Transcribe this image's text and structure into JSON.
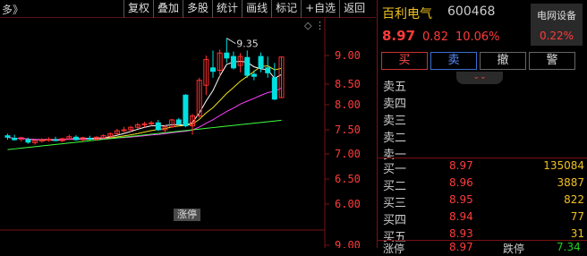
{
  "toolbar": {
    "left_text": "多》",
    "buttons": [
      "复权",
      "叠加",
      "多股",
      "统计",
      "画线",
      "标记",
      "+自选",
      "返回"
    ]
  },
  "chart": {
    "y_labels": [
      "9.00",
      "8.50",
      "8.00",
      "7.50",
      "7.00",
      "6.50",
      "6.00",
      "9.00"
    ],
    "high_marker": "9.35",
    "limit_badge": "涨停",
    "colors": {
      "up": "#ff3030",
      "down": "#00e0e0",
      "ma5": "#ffffff",
      "ma10": "#f0e020",
      "ma20": "#ff40ff",
      "ma60": "#40ff40"
    }
  },
  "stock": {
    "name": "百利电气",
    "code": "600468",
    "price": "8.97",
    "change": "0.82",
    "change_pct": "10.06%"
  },
  "sector": {
    "name": "电网设备",
    "pct": "0.22%"
  },
  "actions": [
    "买",
    "卖",
    "撤",
    "警"
  ],
  "asks": [
    {
      "level": "卖五",
      "price": "",
      "vol": ""
    },
    {
      "level": "卖四",
      "price": "",
      "vol": ""
    },
    {
      "level": "卖三",
      "price": "",
      "vol": ""
    },
    {
      "level": "卖二",
      "price": "",
      "vol": ""
    },
    {
      "level": "卖一",
      "price": "",
      "vol": ""
    }
  ],
  "bids": [
    {
      "level": "买一",
      "price": "8.97",
      "vol": "135084"
    },
    {
      "level": "买二",
      "price": "8.96",
      "vol": "3887"
    },
    {
      "level": "买三",
      "price": "8.95",
      "vol": "822"
    },
    {
      "level": "买四",
      "price": "8.94",
      "vol": "77"
    },
    {
      "level": "买五",
      "price": "8.93",
      "vol": "31"
    }
  ],
  "bottom": {
    "left_label": "涨停",
    "left_value": "8.97",
    "right_label": "跌停",
    "right_value": "7.34"
  }
}
